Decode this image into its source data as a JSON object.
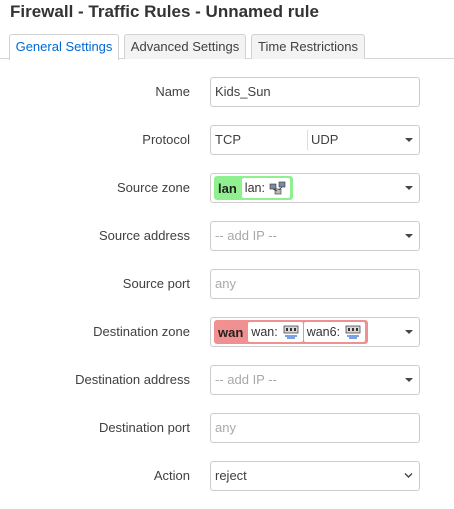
{
  "page": {
    "title": "Firewall - Traffic Rules - Unnamed rule"
  },
  "tabs": [
    {
      "label": "General Settings",
      "active": true
    },
    {
      "label": "Advanced Settings",
      "active": false
    },
    {
      "label": "Time Restrictions",
      "active": false
    }
  ],
  "form": {
    "name": {
      "label": "Name",
      "value": "Kids_Sun"
    },
    "protocol": {
      "label": "Protocol",
      "values": [
        "TCP",
        "UDP"
      ]
    },
    "source_zone": {
      "label": "Source zone",
      "zone": "lan",
      "zone_color": "#90f090",
      "interfaces": [
        {
          "label": "lan:",
          "icon": "bridge-icon"
        }
      ]
    },
    "source_address": {
      "label": "Source address",
      "placeholder": "-- add IP --"
    },
    "source_port": {
      "label": "Source port",
      "placeholder": "any"
    },
    "destination_zone": {
      "label": "Destination zone",
      "zone": "wan",
      "zone_color": "#f09090",
      "interfaces": [
        {
          "label": "wan:",
          "icon": "ethernet-icon"
        },
        {
          "label": "wan6:",
          "icon": "ethernet-icon"
        }
      ]
    },
    "destination_address": {
      "label": "Destination address",
      "placeholder": "-- add IP --"
    },
    "destination_port": {
      "label": "Destination port",
      "placeholder": "any"
    },
    "action": {
      "label": "Action",
      "value": "reject"
    }
  },
  "colors": {
    "accent": "#0069d6",
    "text": "#404040",
    "border": "#cccccc"
  }
}
